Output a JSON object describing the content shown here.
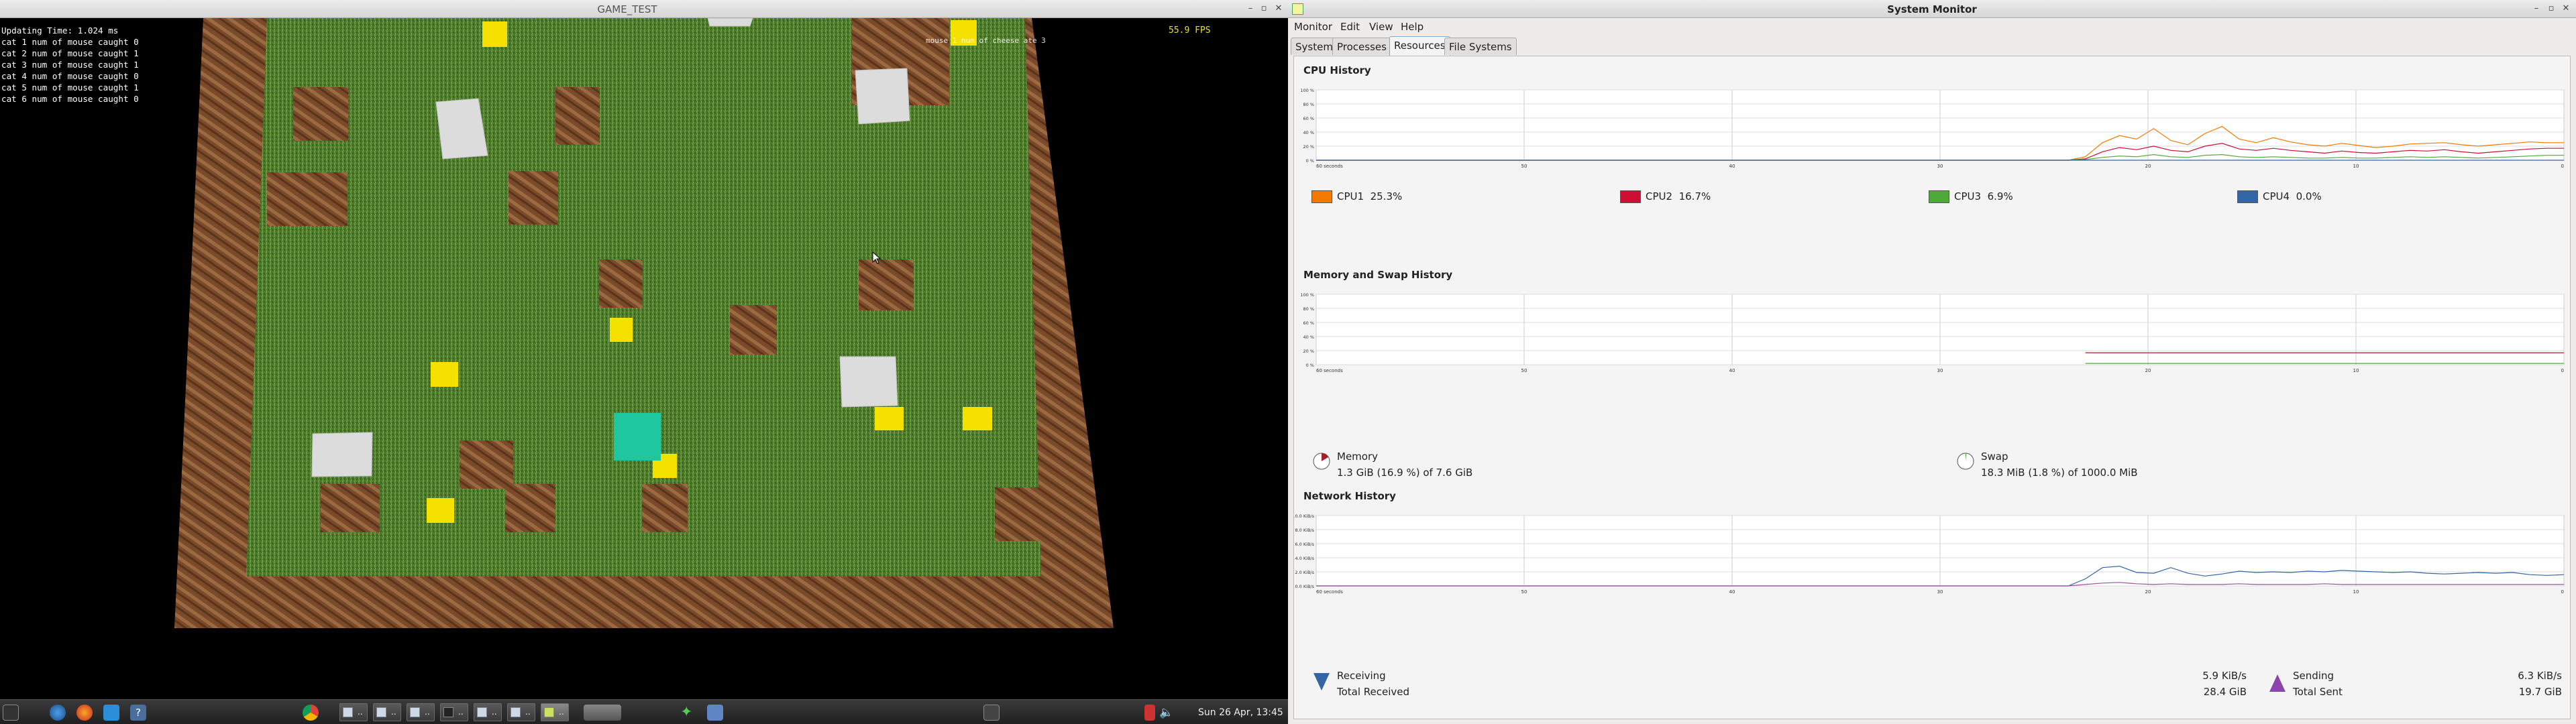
{
  "game": {
    "title": "GAME_TEST",
    "hud_lines": [
      "Updating Time: 1.024 ms",
      "cat 1 num of mouse caught 0",
      "cat 2 num of mouse caught 1",
      "cat 3 num of mouse caught 1",
      "cat 4 num of mouse caught 0",
      "cat 5 num of mouse caught 1",
      "cat 6 num of mouse caught 0"
    ],
    "fps": "55.9 FPS",
    "mouse_message": "mouse 1 num of cheese ate 3",
    "colors": {
      "grass": "#4f7d2c",
      "crate": "#7a4a2a",
      "cheese": "#f4e100",
      "stone": "#d6d6d6",
      "cat": "#1fc7a0"
    }
  },
  "taskbar": {
    "clock": "Sun 26 Apr, 13:45",
    "tasks": [
      {
        "label": ".."
      },
      {
        "label": ".."
      },
      {
        "label": ".."
      },
      {
        "label": ".."
      },
      {
        "label": ".."
      },
      {
        "label": ".."
      },
      {
        "label": ".."
      }
    ]
  },
  "sysmon": {
    "title": "System Monitor",
    "menus": [
      "Monitor",
      "Edit",
      "View",
      "Help"
    ],
    "tabs": [
      "System",
      "Processes",
      "Resources",
      "File Systems"
    ],
    "active_tab": "Resources",
    "cpu": {
      "section_title": "CPU History",
      "y_ticks": [
        "100 %",
        "80 %",
        "60 %",
        "40 %",
        "20 %",
        "0 %"
      ],
      "x_ticks": [
        "60 seconds",
        "50",
        "40",
        "30",
        "20",
        "10",
        "0"
      ],
      "legend": [
        {
          "name": "CPU1",
          "value": "25.3%",
          "color": "#f57900"
        },
        {
          "name": "CPU2",
          "value": "16.7%",
          "color": "#cc0f33"
        },
        {
          "name": "CPU3",
          "value": "6.9%",
          "color": "#4ea83a"
        },
        {
          "name": "CPU4",
          "value": "0.0%",
          "color": "#3465a4"
        }
      ],
      "series": {
        "CPU1": [
          0,
          0,
          0,
          0,
          0,
          0,
          0,
          0,
          0,
          0,
          0,
          0,
          0,
          0,
          0,
          0,
          0,
          0,
          0,
          0,
          0,
          0,
          0,
          0,
          0,
          0,
          0,
          0,
          0,
          0,
          0,
          0,
          0,
          0,
          0,
          0,
          0,
          0,
          0,
          0,
          0,
          0,
          0,
          0,
          0,
          5,
          25,
          35,
          30,
          45,
          28,
          22,
          38,
          48,
          30,
          25,
          32,
          26,
          22,
          20,
          24,
          21,
          18,
          20,
          23,
          24,
          25,
          22,
          20,
          22,
          24,
          26,
          25,
          25
        ],
        "CPU2": [
          0,
          0,
          0,
          0,
          0,
          0,
          0,
          0,
          0,
          0,
          0,
          0,
          0,
          0,
          0,
          0,
          0,
          0,
          0,
          0,
          0,
          0,
          0,
          0,
          0,
          0,
          0,
          0,
          0,
          0,
          0,
          0,
          0,
          0,
          0,
          0,
          0,
          0,
          0,
          0,
          0,
          0,
          0,
          0,
          0,
          2,
          12,
          18,
          15,
          20,
          14,
          12,
          20,
          24,
          16,
          14,
          17,
          14,
          12,
          10,
          13,
          11,
          10,
          12,
          14,
          13,
          15,
          12,
          10,
          12,
          14,
          16,
          17,
          17
        ],
        "CPU3": [
          0,
          0,
          0,
          0,
          0,
          0,
          0,
          0,
          0,
          0,
          0,
          0,
          0,
          0,
          0,
          0,
          0,
          0,
          0,
          0,
          0,
          0,
          0,
          0,
          0,
          0,
          0,
          0,
          0,
          0,
          0,
          0,
          0,
          0,
          0,
          0,
          0,
          0,
          0,
          0,
          0,
          0,
          0,
          0,
          0,
          1,
          4,
          6,
          5,
          8,
          5,
          4,
          7,
          8,
          5,
          4,
          5,
          4,
          3,
          3,
          4,
          3,
          3,
          4,
          5,
          4,
          5,
          4,
          3,
          4,
          5,
          6,
          7,
          7
        ],
        "CPU4": [
          0,
          0,
          0,
          0,
          0,
          0,
          0,
          0,
          0,
          0,
          0,
          0,
          0,
          0,
          0,
          0,
          0,
          0,
          0,
          0,
          0,
          0,
          0,
          0,
          0,
          0,
          0,
          0,
          0,
          0,
          0,
          0,
          0,
          0,
          0,
          0,
          0,
          0,
          0,
          0,
          0,
          0,
          0,
          0,
          0,
          0,
          0,
          0,
          0,
          0,
          0,
          0,
          0,
          0,
          0,
          0,
          0,
          0,
          0,
          0,
          0,
          0,
          0,
          0,
          0,
          0,
          0,
          0,
          0,
          0,
          0,
          0,
          0,
          0
        ]
      }
    },
    "memory": {
      "section_title": "Memory and Swap History",
      "memory_label": "Memory",
      "memory_value": "1.3 GiB (16.9 %) of 7.6 GiB",
      "swap_label": "Swap",
      "swap_value": "18.3 MiB (1.8 %) of 1000.0 MiB",
      "memory_percent": 16.9,
      "swap_percent": 1.8,
      "memory_color": "#a4202e",
      "swap_color": "#4ea83a"
    },
    "network": {
      "section_title": "Network History",
      "y_ticks": [
        "10.0 KiB/s",
        "8.0 KiB/s",
        "6.0 KiB/s",
        "4.0 KiB/s",
        "2.0 KiB/s",
        "0.0 KiB/s"
      ],
      "receiving_label": "Receiving",
      "receiving_value": "5.9 KiB/s",
      "total_received_label": "Total Received",
      "total_received_value": "28.4 GiB",
      "sending_label": "Sending",
      "sending_value": "6.3 KiB/s",
      "total_sent_label": "Total Sent",
      "total_sent_value": "19.7 GiB",
      "receive_color": "#3465a4",
      "send_color": "#a34ea0",
      "recv_series": [
        0,
        0,
        0,
        0,
        0,
        0,
        0,
        0,
        0,
        0,
        0,
        0,
        0,
        0,
        0,
        0,
        0,
        0,
        0,
        0,
        0,
        0,
        0,
        0,
        0,
        0,
        0,
        0,
        0,
        0,
        0,
        0,
        0,
        0,
        0,
        0,
        0,
        0,
        0,
        0,
        0,
        0,
        0,
        0,
        0,
        1,
        2.6,
        2.8,
        1.9,
        1.8,
        2.6,
        1.8,
        1.4,
        1.7,
        2.1,
        1.9,
        2.0,
        1.9,
        2.1,
        2.0,
        2.2,
        2.1,
        2.0,
        1.9,
        2.0,
        1.8,
        1.7,
        1.8,
        1.9,
        1.8,
        1.9,
        1.6,
        1.5,
        1.6
      ],
      "send_series": [
        0,
        0,
        0,
        0,
        0,
        0,
        0,
        0,
        0,
        0,
        0,
        0,
        0,
        0,
        0,
        0,
        0,
        0,
        0,
        0,
        0,
        0,
        0,
        0,
        0,
        0,
        0,
        0,
        0,
        0,
        0,
        0,
        0,
        0,
        0,
        0,
        0,
        0,
        0,
        0,
        0,
        0,
        0,
        0,
        0,
        0.2,
        0.4,
        0.5,
        0.3,
        0.2,
        0.3,
        0.2,
        0.2,
        0.2,
        0.3,
        0.2,
        0.2,
        0.2,
        0.2,
        0.3,
        0.2,
        0.2,
        0.2,
        0.2,
        0.2,
        0.2,
        0.2,
        0.2,
        0.2,
        0.2,
        0.2,
        0.2,
        0.2,
        0.2
      ]
    }
  }
}
